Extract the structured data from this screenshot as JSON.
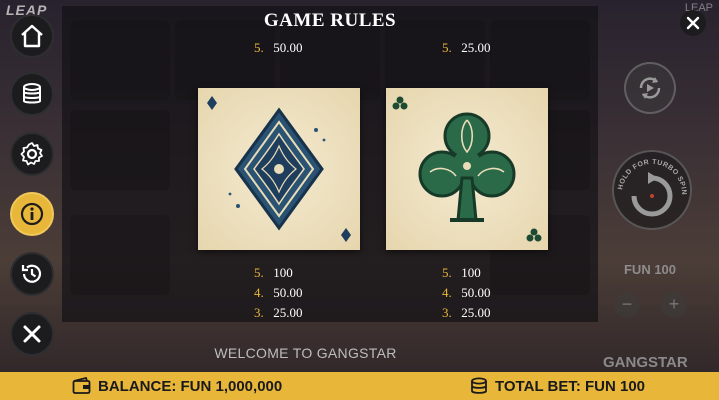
{
  "header": {
    "brand": "LEAP",
    "brand_right": "LEAP"
  },
  "modal": {
    "title": "GAME RULES",
    "top_left_partial": {
      "num": "5.",
      "value": "50.00"
    },
    "top_right_partial": {
      "num": "5.",
      "value": "25.00"
    },
    "left_card": {
      "symbol": "diamond-card",
      "payouts": [
        {
          "num": "5.",
          "value": "100"
        },
        {
          "num": "4.",
          "value": "50.00"
        },
        {
          "num": "3.",
          "value": "25.00"
        }
      ]
    },
    "right_card": {
      "symbol": "club-card",
      "payouts": [
        {
          "num": "5.",
          "value": "100"
        },
        {
          "num": "4.",
          "value": "50.00"
        },
        {
          "num": "3.",
          "value": "25.00"
        }
      ]
    }
  },
  "controls": {
    "spin_hint": "HOLD FOR TURBO SPIN",
    "bet_value": "FUN 100",
    "minus": "−",
    "plus": "+"
  },
  "status": {
    "welcome": "WELCOME TO GANGSTAR",
    "game_name": "GANGSTAR",
    "balance_label": "BALANCE: FUN 1,000,000",
    "total_bet_label": "TOTAL BET: FUN 100"
  },
  "colors": {
    "accent": "#e8b73a",
    "diamond": "#1f3d5c",
    "club": "#1e4a34",
    "card_bg": "#efe3c4"
  }
}
